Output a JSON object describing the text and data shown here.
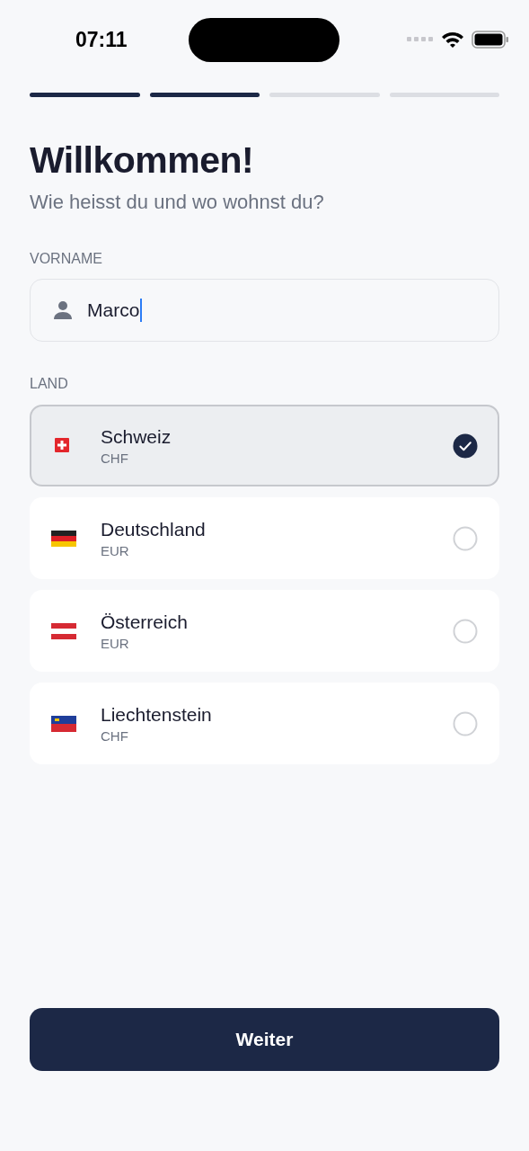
{
  "status_bar": {
    "time": "07:11"
  },
  "progress": [
    {
      "completed": true
    },
    {
      "completed": true
    },
    {
      "completed": false
    },
    {
      "completed": false
    }
  ],
  "title": "Willkommen!",
  "subtitle": "Wie heisst du und wo wohnst du?",
  "name_field": {
    "label": "VORNAME",
    "value": "Marco"
  },
  "country_section": {
    "label": "LAND"
  },
  "countries": [
    {
      "kind": "ch",
      "name": "Schweiz",
      "currency": "CHF",
      "selected": true
    },
    {
      "kind": "de",
      "name": "Deutschland",
      "currency": "EUR",
      "selected": false
    },
    {
      "kind": "at",
      "name": "Österreich",
      "currency": "EUR",
      "selected": false
    },
    {
      "kind": "li",
      "name": "Liechtenstein",
      "currency": "CHF",
      "selected": false
    }
  ],
  "button": {
    "label": "Weiter"
  }
}
